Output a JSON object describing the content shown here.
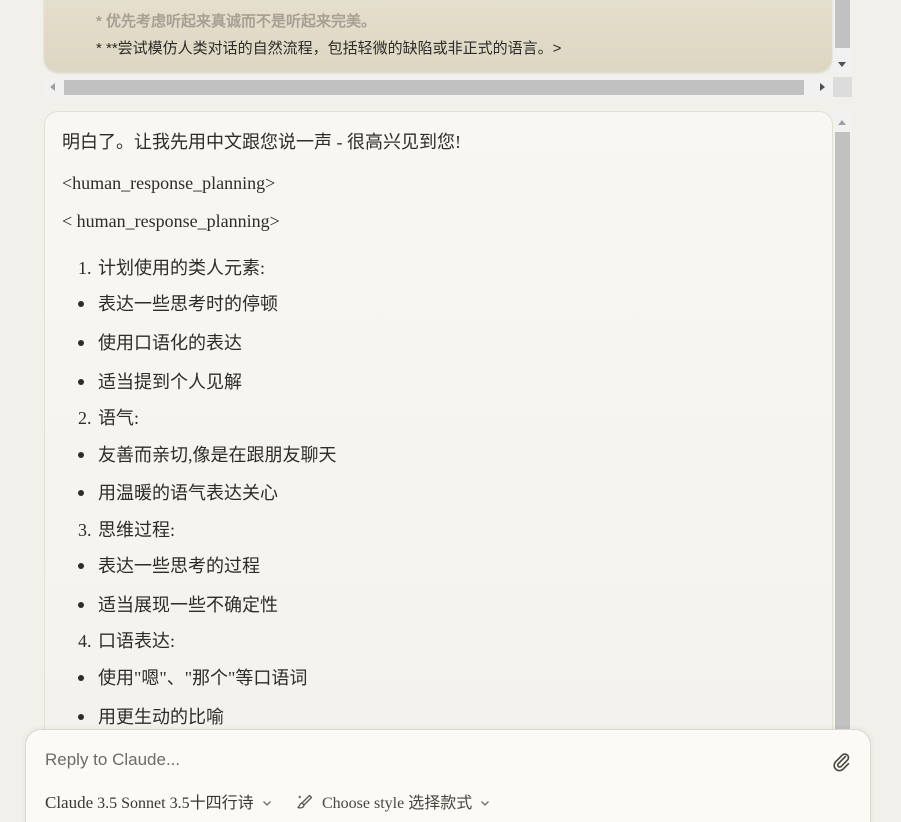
{
  "user_message": {
    "line1": "* 优先考虑听起来真诚而不是听起来完美。",
    "line2": "* **尝试模仿人类对话的自然流程，包括轻微的缺陷或非正式的语言。>"
  },
  "assistant": {
    "intro": "明白了。让我先用中文跟您说一声 - 很高兴见到您!",
    "tag1": "<human_response_planning>",
    "tag2": "< human_response_planning>",
    "sections": [
      {
        "number": "1.",
        "title": "计划使用的类人元素:",
        "items": [
          "表达一些思考时的停顿",
          "使用口语化的表达",
          "适当提到个人见解"
        ]
      },
      {
        "number": "2.",
        "title": "语气:",
        "items": [
          "友善而亲切,像是在跟朋友聊天",
          "用温暖的语气表达关心"
        ]
      },
      {
        "number": "3.",
        "title": "思维过程:",
        "items": [
          "表达一些思考的过程",
          "适当展现一些不确定性"
        ]
      },
      {
        "number": "4.",
        "title": "口语表达:",
        "items": [
          "使用\"嗯\"、\"那个\"等口语词",
          "用更生动的比喻"
        ]
      }
    ]
  },
  "composer": {
    "placeholder": "Reply to Claude...",
    "model_name": "Claude",
    "model_version": "3.5 Sonnet 3.5十四行诗",
    "style_label": "Choose style 选择款式"
  },
  "icons": {
    "attach": "paperclip-icon",
    "model_chevron": "chevron-down-icon",
    "style": "brush-icon",
    "style_chevron": "chevron-down-icon"
  }
}
